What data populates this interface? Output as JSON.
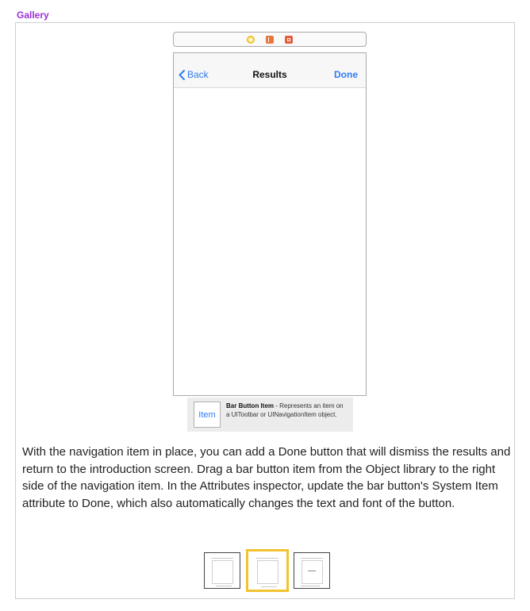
{
  "gallery": {
    "title": "Gallery"
  },
  "scene_bar": {
    "icons": [
      "view-controller-icon",
      "first-responder-icon",
      "exit-icon"
    ]
  },
  "navigation": {
    "back_label": "Back",
    "title": "Results",
    "done_label": "Done"
  },
  "library_item": {
    "icon_label": "Item",
    "name": "Bar Button Item",
    "description": " - Represents an item on a UIToolbar or UINavigationItem object."
  },
  "description": "With the navigation item in place, you can add a Done button that will dismiss the results and return to the introduction screen. Drag a bar button item from the Object library to the right side of the navigation item. In the Attributes inspector, update the bar button's System Item attribute to Done, which also automatically changes the text and font of the button.",
  "thumbnails": {
    "count": 3,
    "active_index": 1
  },
  "colors": {
    "accent": "#2f7cf6",
    "gallery_title": "#9b30d9",
    "active_thumb": "#f2c230"
  }
}
